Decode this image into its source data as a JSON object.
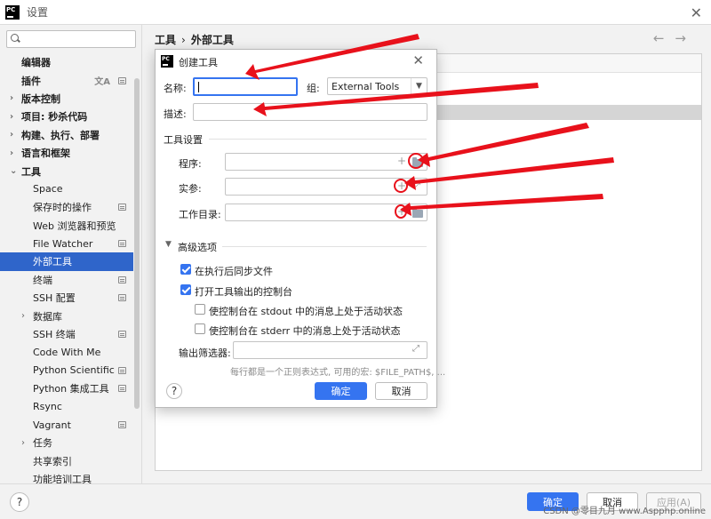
{
  "window": {
    "title": "设置",
    "app_logo": "PC"
  },
  "search": {
    "placeholder": ""
  },
  "sidebar": {
    "items": [
      {
        "label": "编辑器",
        "bold": true,
        "level": 0,
        "arrow": ""
      },
      {
        "label": "插件",
        "bold": true,
        "level": 0,
        "arrow": ""
      },
      {
        "label": "版本控制",
        "bold": true,
        "level": 0,
        "arrow": "›"
      },
      {
        "label": "项目: 秒杀代码",
        "bold": true,
        "level": 0,
        "arrow": "›"
      },
      {
        "label": "构建、执行、部署",
        "bold": true,
        "level": 0,
        "arrow": "›"
      },
      {
        "label": "语言和框架",
        "bold": true,
        "level": 0,
        "arrow": "›"
      },
      {
        "label": "工具",
        "bold": true,
        "level": 0,
        "arrow": "⌄"
      },
      {
        "label": "Space",
        "bold": false,
        "level": 1,
        "arrow": ""
      },
      {
        "label": "保存时的操作",
        "bold": false,
        "level": 1,
        "arrow": ""
      },
      {
        "label": "Web 浏览器和预览",
        "bold": false,
        "level": 1,
        "arrow": ""
      },
      {
        "label": "File Watcher",
        "bold": false,
        "level": 1,
        "arrow": ""
      },
      {
        "label": "外部工具",
        "bold": false,
        "level": 1,
        "arrow": ""
      },
      {
        "label": "终端",
        "bold": false,
        "level": 1,
        "arrow": ""
      },
      {
        "label": "SSH 配置",
        "bold": false,
        "level": 1,
        "arrow": ""
      },
      {
        "label": "数据库",
        "bold": false,
        "level": 1,
        "arrow": "›"
      },
      {
        "label": "SSH 终端",
        "bold": false,
        "level": 1,
        "arrow": ""
      },
      {
        "label": "Code With Me",
        "bold": false,
        "level": 1,
        "arrow": ""
      },
      {
        "label": "Python Scientific",
        "bold": false,
        "level": 1,
        "arrow": ""
      },
      {
        "label": "Python 集成工具",
        "bold": false,
        "level": 1,
        "arrow": ""
      },
      {
        "label": "Rsync",
        "bold": false,
        "level": 1,
        "arrow": ""
      },
      {
        "label": "Vagrant",
        "bold": false,
        "level": 1,
        "arrow": ""
      },
      {
        "label": "任务",
        "bold": false,
        "level": 1,
        "arrow": "›"
      },
      {
        "label": "共享索引",
        "bold": false,
        "level": 1,
        "arrow": ""
      },
      {
        "label": "功能培训工具",
        "bold": false,
        "level": 1,
        "arrow": ""
      }
    ]
  },
  "breadcrumb": {
    "parent": "工具",
    "separator": "›",
    "current": "外部工具"
  },
  "nav": {
    "back": "←",
    "forward": "→"
  },
  "dialog": {
    "title": "创建工具",
    "name_label": "名称:",
    "name_value": "",
    "group_label": "组:",
    "group_value": "External Tools",
    "desc_label": "描述:",
    "desc_value": "",
    "tool_settings_title": "工具设置",
    "program_label": "程序:",
    "args_label": "实参:",
    "workdir_label": "工作目录:",
    "advanced_title": "高级选项",
    "sync_files_label": "在执行后同步文件",
    "sync_files_checked": true,
    "open_console_label": "打开工具输出的控制台",
    "open_console_checked": true,
    "stdout_label": "使控制台在 stdout 中的消息上处于活动状态",
    "stdout_checked": false,
    "stderr_label": "使控制台在 stderr 中的消息上处于活动状态",
    "stderr_checked": false,
    "output_filters_label": "输出筛选器:",
    "hint": "每行都是一个正则表达式, 可用的宏: $FILE_PATH$, ...",
    "help": "?",
    "ok": "确定",
    "cancel": "取消"
  },
  "bottom": {
    "help": "?",
    "ok": "确定",
    "cancel": "取消",
    "apply": "应用(A)"
  },
  "watermark": "CSDN @零目九月 www.Aspphp.online",
  "colors": {
    "selection": "#2f65ca",
    "primary_button": "#3574f0",
    "annotation": "#e8111b"
  },
  "icons": [
    "search-icon",
    "close-icon",
    "folder-icon",
    "plus-icon",
    "expand-icon",
    "help-icon",
    "back-arrow-icon",
    "forward-arrow-icon",
    "translate-icon"
  ]
}
